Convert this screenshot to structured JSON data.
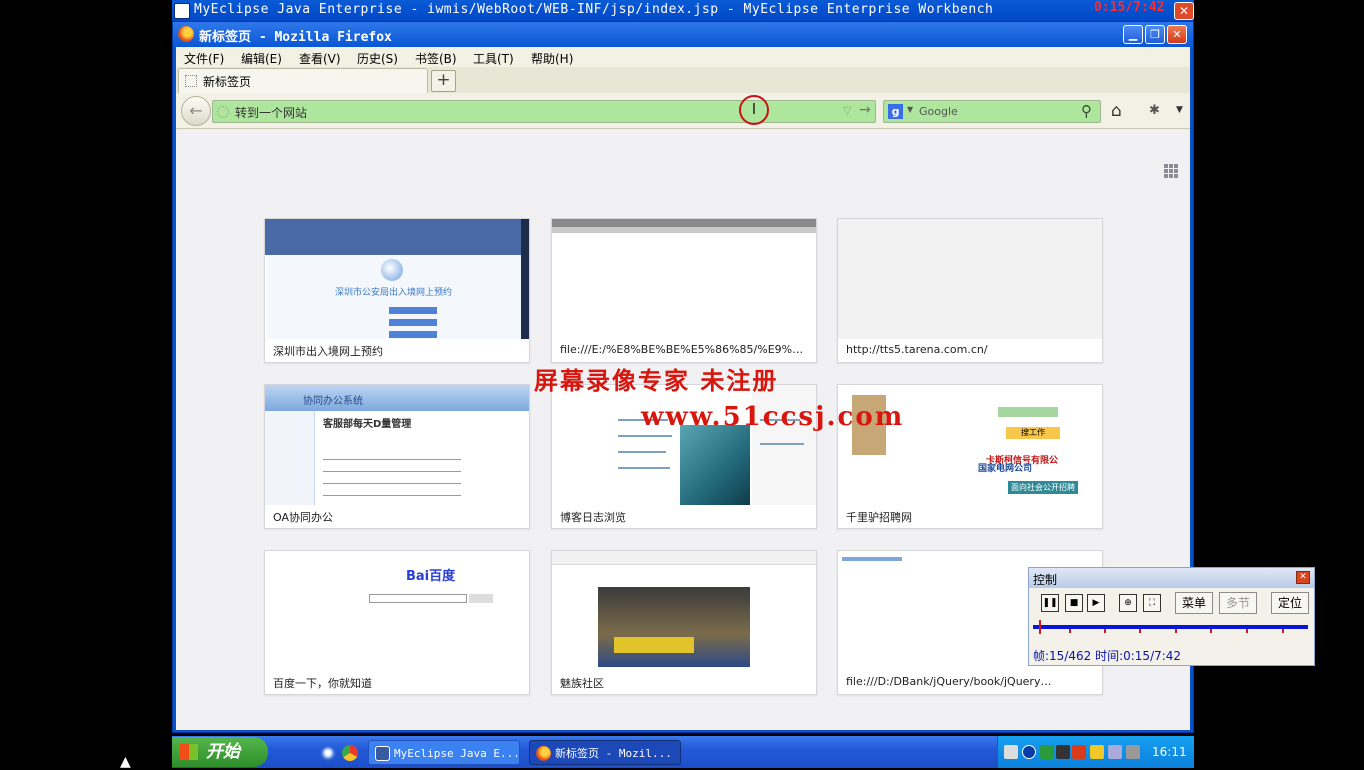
{
  "eclipse": {
    "title": "MyEclipse Java Enterprise - iwmis/WebRoot/WEB-INF/jsp/index.jsp - MyEclipse Enterprise Workbench",
    "recorder_time": "0:15/7:42"
  },
  "firefox": {
    "title": "新标签页 - Mozilla Firefox",
    "menu": [
      "文件(F)",
      "编辑(E)",
      "查看(V)",
      "历史(S)",
      "书签(B)",
      "工具(T)",
      "帮助(H)"
    ],
    "tab_label": "新标签页",
    "new_tab_symbol": "+",
    "url_placeholder": "转到一个网站",
    "search_engine": "Google",
    "search_placeholder": "Google"
  },
  "tiles": [
    {
      "caption": "深圳市出入境网上预约",
      "thumb_heading": "深圳市公安局出入境网上预约"
    },
    {
      "caption": "file:///E:/%E8%BE%BE%E5%86%85/%E9%A1%B9…"
    },
    {
      "caption": "http://tts5.tarena.com.cn/"
    },
    {
      "caption": "OA协同办公",
      "thumb_app": "协同办公系统",
      "thumb_heading": "客服部每天D量管理"
    },
    {
      "caption": "博客日志浏览"
    },
    {
      "caption": "千里驴招聘网",
      "thumb_company": "卡斯柯信号有限公",
      "thumb_state": "国家电网公司",
      "thumb_state2": "面向社会公开招聘",
      "thumb_button": "搜工作"
    },
    {
      "caption": "百度一下，你就知道",
      "thumb_logo": "Bai百度"
    },
    {
      "caption": "魅族社区"
    },
    {
      "caption": "file:///D:/DBank/jQuery/book/jQuery…"
    }
  ],
  "watermark": {
    "line1": "屏幕录像专家  未注册",
    "line2": "www.51ccsj.com"
  },
  "control_panel": {
    "title": "控制",
    "buttons": [
      "菜单",
      "多节",
      "定位"
    ],
    "progress": 0.03,
    "frame_info": "帧:15/462 时间:0:15/7:42"
  },
  "taskbar": {
    "start": "开始",
    "tasks": [
      "MyEclipse Java E...",
      "新标签页 - Mozil..."
    ],
    "clock": "16:11"
  },
  "colors": {
    "xp_blue": "#0a57d4",
    "url_green": "#aee69e",
    "watermark_red": "#d8160e",
    "start_green": "#3ca236"
  }
}
